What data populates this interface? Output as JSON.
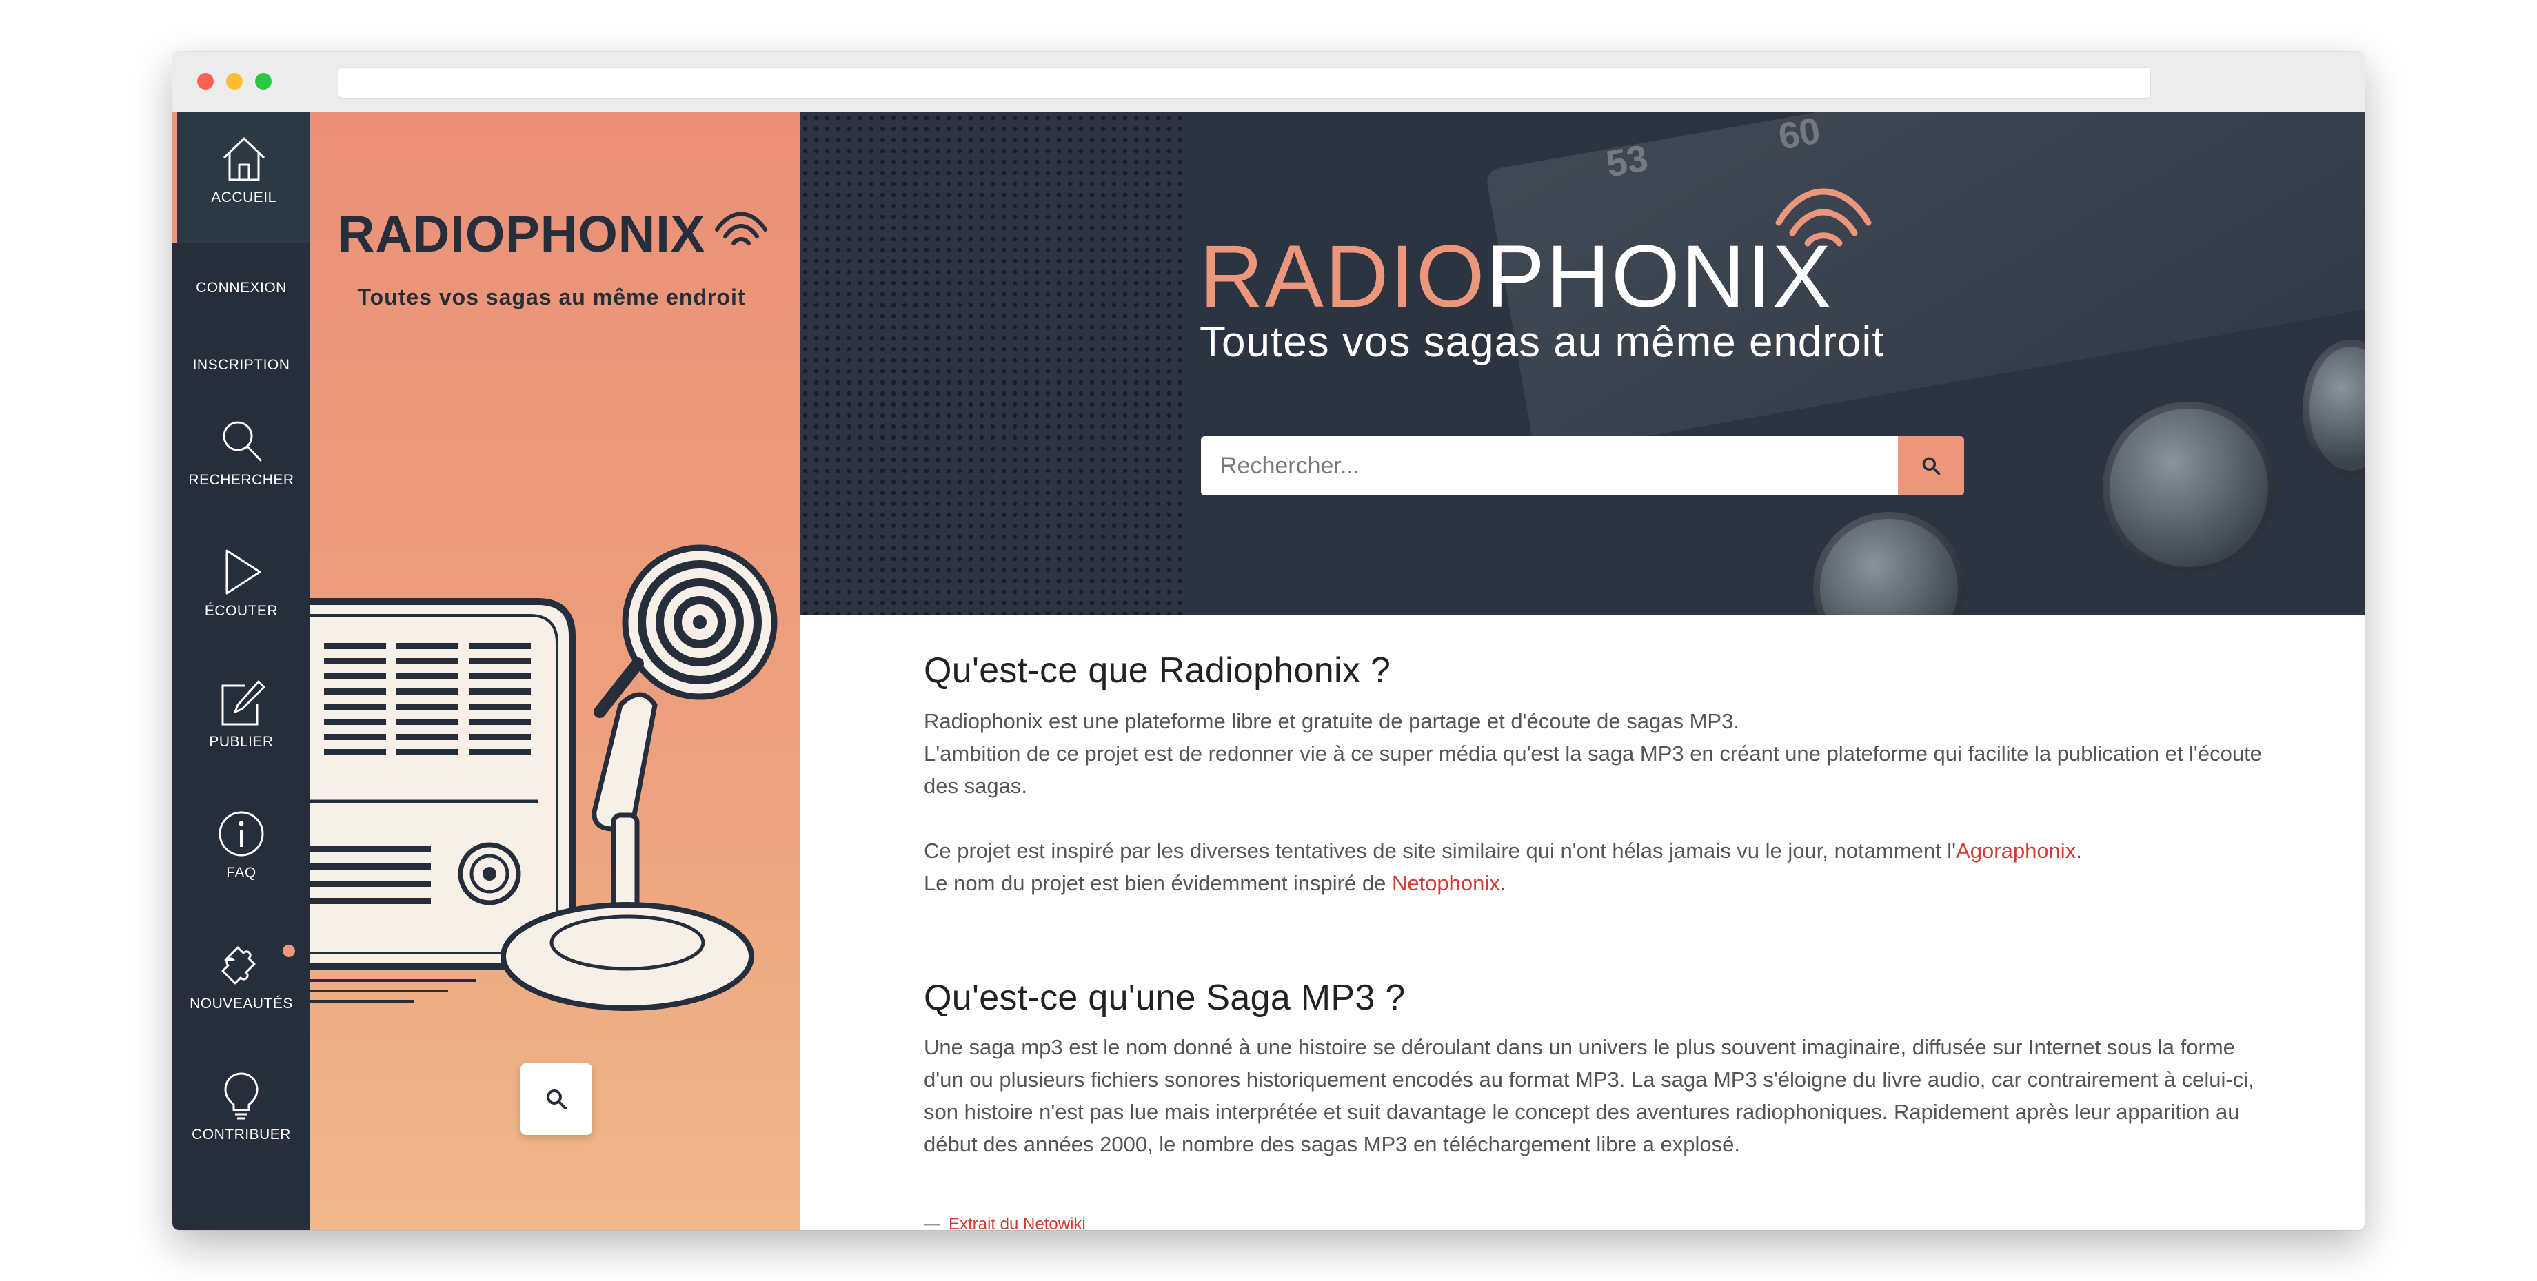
{
  "nav": {
    "items": [
      {
        "label": "ACCUEIL",
        "icon": "home-icon"
      },
      {
        "label": "CONNEXION"
      },
      {
        "label": "INSCRIPTION"
      },
      {
        "label": "RECHERCHER",
        "icon": "search-icon"
      },
      {
        "label": "ÉCOUTER",
        "icon": "play-icon"
      },
      {
        "label": "PUBLIER",
        "icon": "edit-icon"
      },
      {
        "label": "FAQ",
        "icon": "info-icon"
      },
      {
        "label": "NOUVEAUTÉS",
        "icon": "puzzle-icon"
      },
      {
        "label": "CONTRIBUER",
        "icon": "lightbulb-icon"
      }
    ]
  },
  "sidebar": {
    "logo": "RADIOPHONIX",
    "tagline": "Toutes vos sagas au même endroit"
  },
  "hero": {
    "logo_part1": "RADIO",
    "logo_part2": "PHONIX",
    "tagline": "Toutes vos sagas au même endroit",
    "search_placeholder": "Rechercher..."
  },
  "section1": {
    "title": "Qu'est-ce que Radiophonix ?",
    "line1": "Radiophonix est une plateforme libre et gratuite de partage et d'écoute de sagas MP3.",
    "line2": "L'ambition de ce projet est de redonner vie à ce super média qu'est la saga MP3 en créant une plateforme qui facilite la publication et l'écoute des sagas.",
    "line3_pre": "Ce projet est inspiré par les diverses tentatives de site similaire qui n'ont hélas jamais vu le jour, notamment l'",
    "line3_link": "Agoraphonix",
    "line3_post": ".",
    "line4_pre": "Le nom du projet est bien évidemment inspiré de ",
    "line4_link": "Netophonix",
    "line4_post": "."
  },
  "section2": {
    "title": "Qu'est-ce qu'une Saga MP3 ?",
    "text": "Une saga mp3 est le nom donné à une histoire se déroulant dans un univers le plus souvent imaginaire, diffusée sur Internet sous la forme d'un ou plusieurs fichiers sonores historiquement encodés au format MP3. La saga MP3 s'éloigne du livre audio, car contrairement à celui-ci, son histoire n'est pas lue mais interprétée et suit davantage le concept des aventures radiophoniques. Rapidement après leur apparition au début des années 2000, le nombre des sagas MP3 en téléchargement libre a explosé.",
    "source": "Extrait du Netowiki"
  },
  "colors": {
    "accent": "#ec967c",
    "nav_bg": "#252e3a",
    "link": "#d23d32"
  }
}
